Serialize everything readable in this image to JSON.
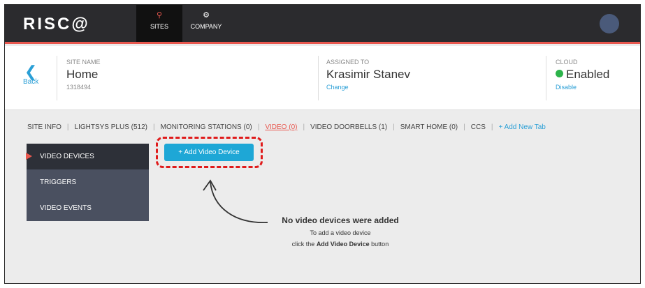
{
  "logo": "RISC@",
  "nav": {
    "sites": {
      "label": "SITES",
      "icon": "location-pin-icon"
    },
    "company": {
      "label": "COMPANY",
      "icon": "gear-icon"
    }
  },
  "header": {
    "back_label": "Back",
    "site_name_caption": "SITE NAME",
    "site_name": "Home",
    "site_id": "1318494",
    "assigned_caption": "ASSIGNED TO",
    "assigned_to": "Krasimir Stanev",
    "change_link": "Change",
    "cloud_caption": "CLOUD",
    "cloud_status": "Enabled",
    "disable_link": "Disable"
  },
  "tabs": [
    {
      "label": "SITE INFO"
    },
    {
      "label": "LIGHTSYS PLUS (512)"
    },
    {
      "label": "MONITORING STATIONS (0)"
    },
    {
      "label": "VIDEO (0)"
    },
    {
      "label": "VIDEO DOORBELLS (1)"
    },
    {
      "label": "SMART HOME (0)"
    },
    {
      "label": "CCS"
    },
    {
      "label": "+ Add New Tab"
    }
  ],
  "sidemenu": [
    {
      "label": "VIDEO DEVICES"
    },
    {
      "label": "TRIGGERS"
    },
    {
      "label": "VIDEO EVENTS"
    }
  ],
  "add_button_label": "+ Add Video Device",
  "empty": {
    "title": "No video devices were added",
    "line1": "To add a video device",
    "line2_prefix": "click the ",
    "line2_bold": "Add Video Device",
    "line2_suffix": " button"
  },
  "colors": {
    "accent": "#e8584f",
    "link": "#2a9fd6",
    "button": "#1ea7d6",
    "status_enabled": "#2cb34a",
    "highlight": "#e01b1b"
  }
}
